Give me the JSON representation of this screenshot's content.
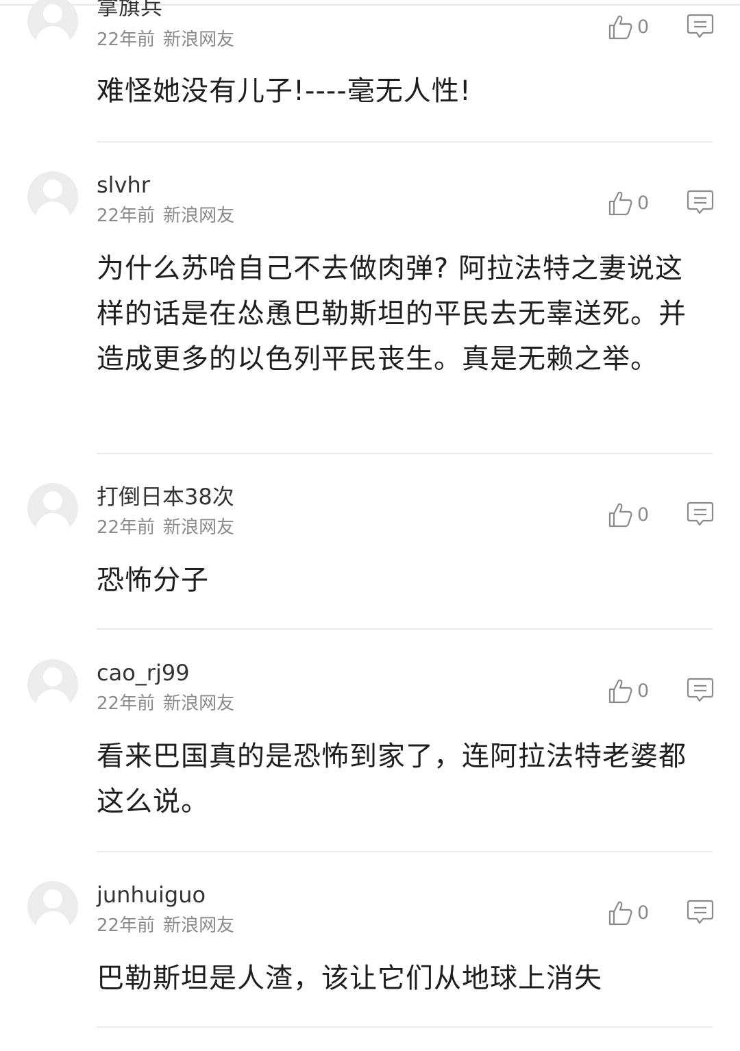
{
  "comments": [
    {
      "username": "拿旗兵",
      "time": "22年前",
      "source": "新浪网友",
      "likes": "0",
      "text": "难怪她没有儿子!----毫无人性!"
    },
    {
      "username": "slvhr",
      "time": "22年前",
      "source": "新浪网友",
      "likes": "0",
      "text": "为什么苏哈自己不去做肉弹? 阿拉法特之妻说这样的话是在怂恿巴勒斯坦的平民去无辜送死。并造成更多的以色列平民丧生。真是无赖之举。"
    },
    {
      "username": "打倒日本38次",
      "time": "22年前",
      "source": "新浪网友",
      "likes": "0",
      "text": "恐怖分子"
    },
    {
      "username": "cao_rj99",
      "time": "22年前",
      "source": "新浪网友",
      "likes": "0",
      "text": "看来巴国真的是恐怖到家了，连阿拉法特老婆都这么说。"
    },
    {
      "username": "junhuiguo",
      "time": "22年前",
      "source": "新浪网友",
      "likes": "0",
      "text": "巴勒斯坦是人渣，该让它们从地球上消失"
    }
  ]
}
